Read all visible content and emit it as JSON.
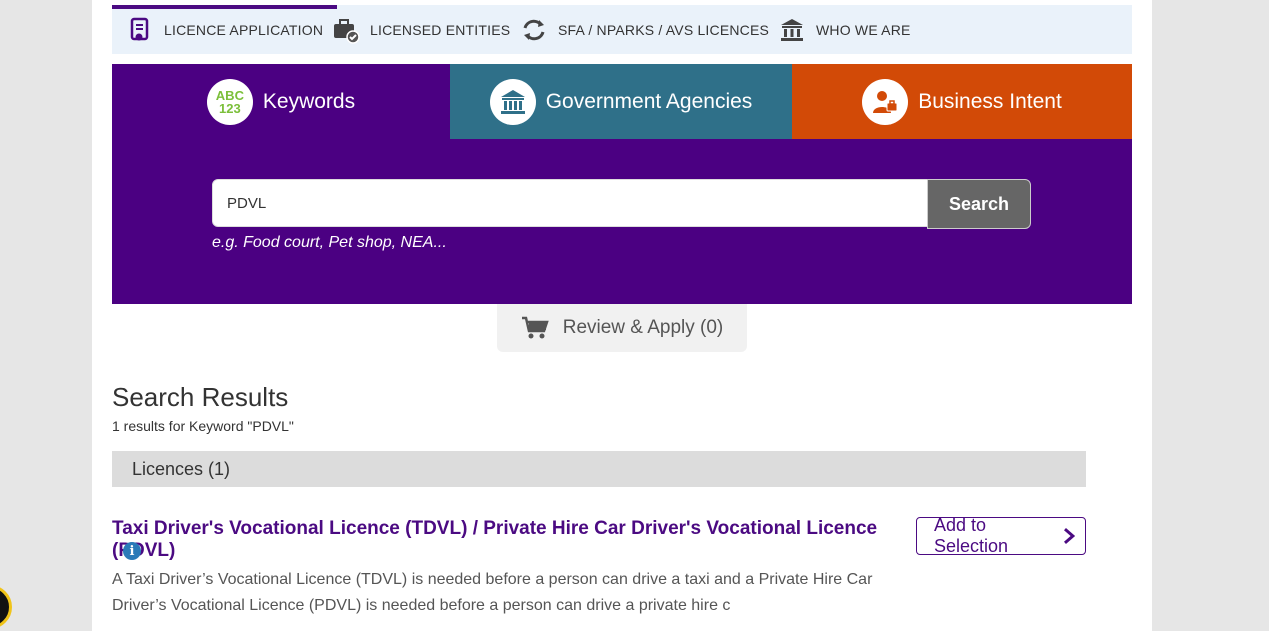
{
  "topnav": {
    "tabs": [
      {
        "label": "LICENCE APPLICATION",
        "icon": "document-icon",
        "active": true
      },
      {
        "label": "LICENSED ENTITIES",
        "icon": "briefcase-check-icon",
        "active": false
      },
      {
        "label": "SFA / NPARKS / AVS LICENCES",
        "icon": "sync-arrows-icon",
        "active": false
      },
      {
        "label": "WHO WE ARE",
        "icon": "building-icon",
        "active": false
      }
    ]
  },
  "categories": {
    "keywords": {
      "label": "Keywords",
      "icon_text_top": "ABC",
      "icon_text_bottom": "123",
      "color": "#4b0082"
    },
    "government": {
      "label": "Government Agencies",
      "color": "#2f7089"
    },
    "business": {
      "label": "Business Intent",
      "color": "#d24a07"
    }
  },
  "search": {
    "value": "PDVL",
    "button_label": "Search",
    "hint": "e.g. Food court, Pet shop, NEA..."
  },
  "review": {
    "label": "Review & Apply (0)"
  },
  "results": {
    "title": "Search Results",
    "subtitle": "1 results for Keyword \"PDVL\"",
    "section_label": "Licences (1)",
    "items": [
      {
        "title": "Taxi Driver's Vocational Licence (TDVL) / Private Hire Car Driver's Vocational Licence (PDVL)",
        "description": "A Taxi Driver’s Vocational Licence (TDVL) is needed before a person can drive a taxi and a Private Hire Car Driver’s Vocational Licence (PDVL) is needed before a person can drive a private hire c",
        "add_label": "Add to Selection",
        "info_glyph": "i"
      }
    ]
  }
}
